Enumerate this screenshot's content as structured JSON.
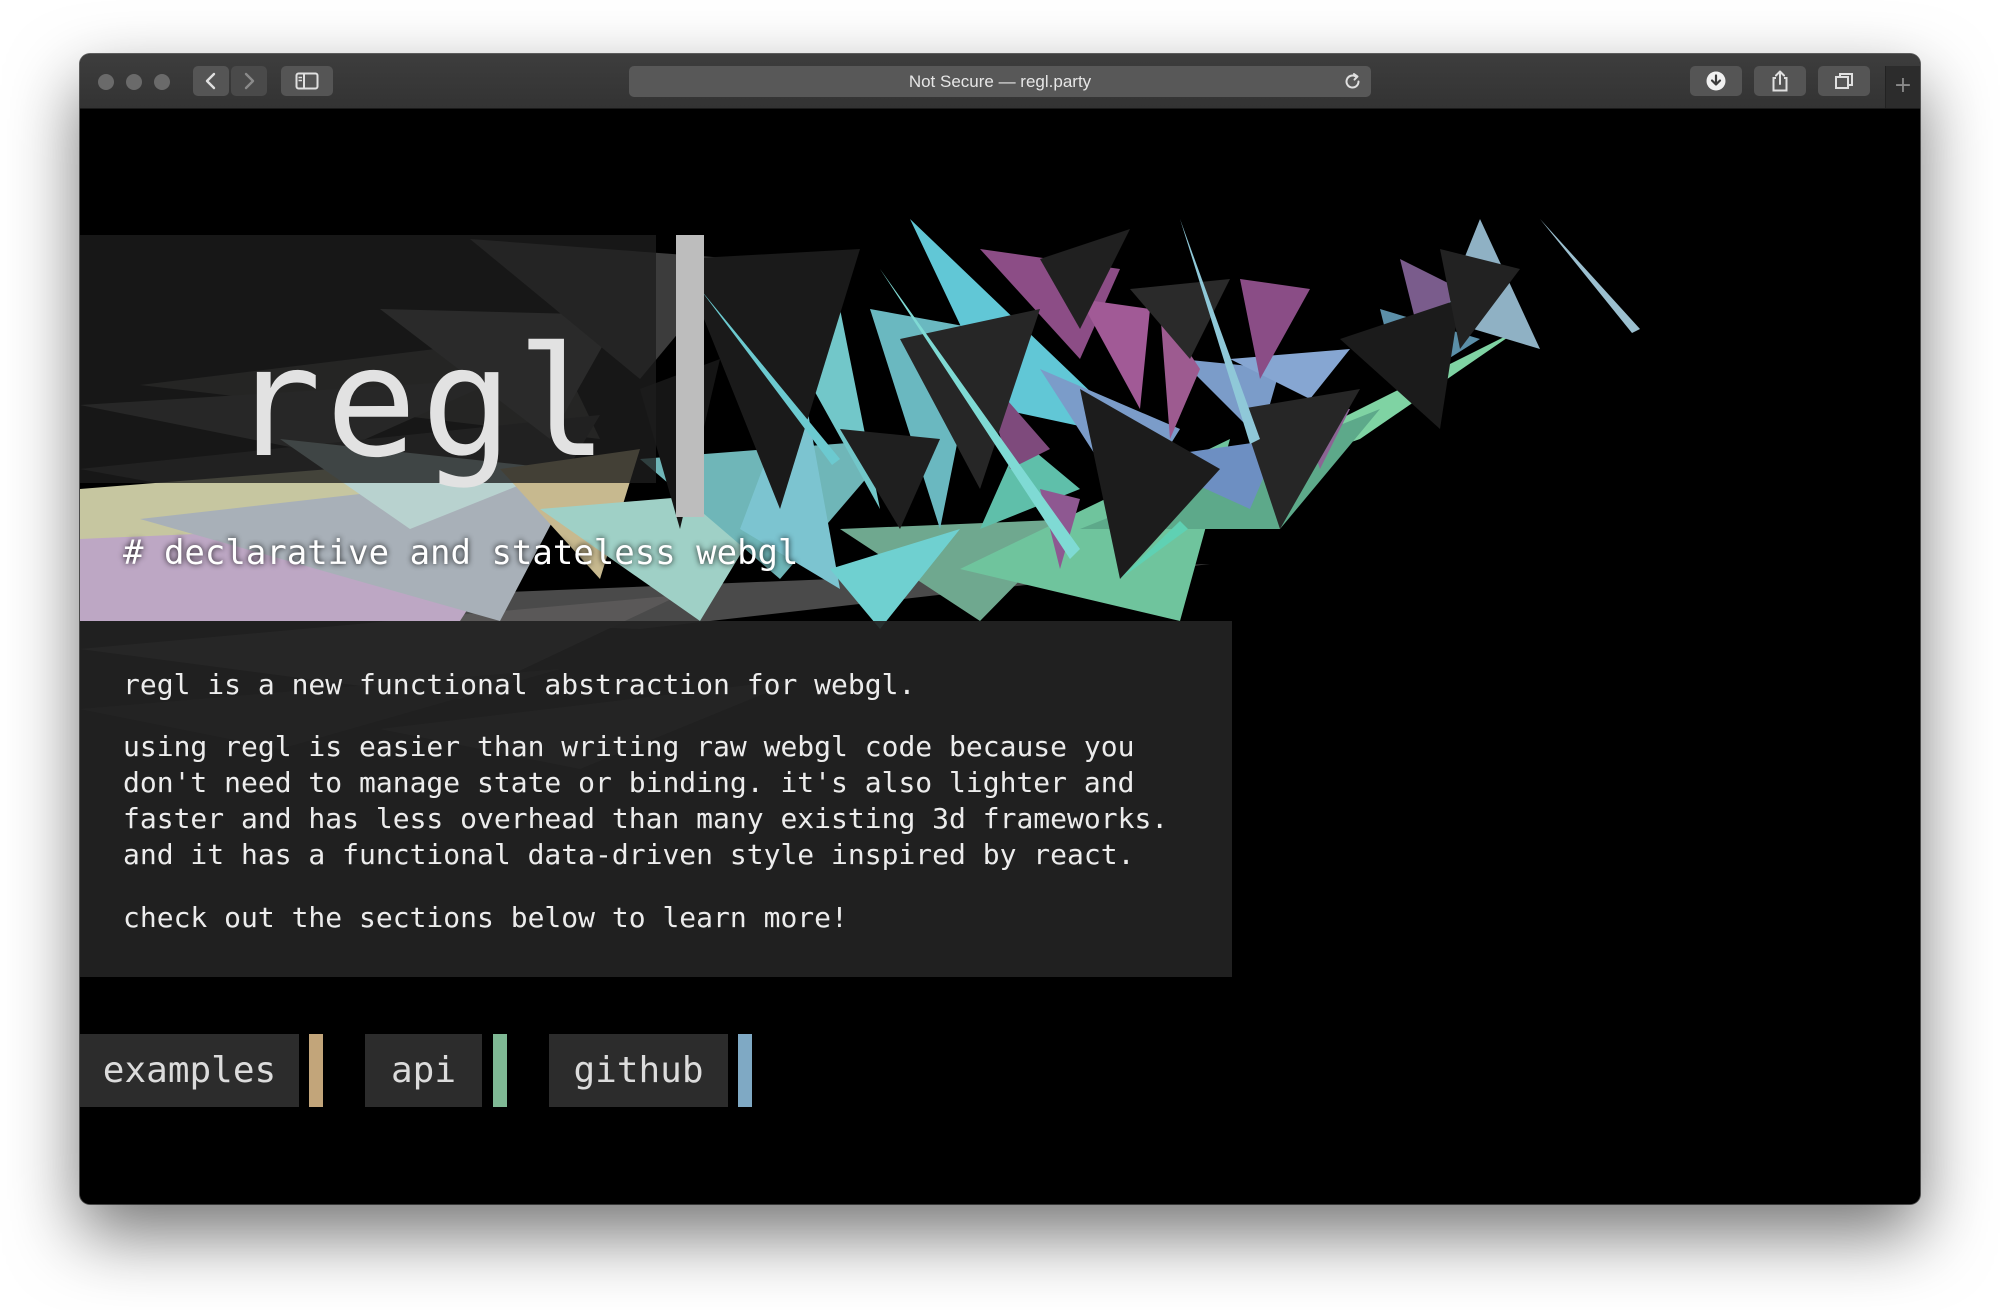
{
  "browser": {
    "url_text": "Not Secure — regl.party",
    "traffic_lights": [
      "close",
      "minimize",
      "zoom"
    ],
    "new_tab_label": "+"
  },
  "hero": {
    "logo": "regl",
    "tagline": "# declarative and stateless webgl"
  },
  "intro": {
    "line1": "regl is a new functional abstraction for webgl.",
    "para2": [
      "using regl is easier than writing raw webgl code because you",
      "don't need to manage state or binding. it's also lighter and",
      "faster and has less overhead than many existing 3d frameworks.",
      "and it has a functional data-driven style inspired by react."
    ],
    "line3": "check out the sections below to learn more!"
  },
  "nav": {
    "examples": "examples",
    "api": "api",
    "github": "github"
  },
  "colors": {
    "examples_accent": "#c2a57a",
    "api_accent": "#7eb894",
    "github_accent": "#7fa9c4",
    "teal": "#72c7c9",
    "purple": "#8c4d86",
    "blue": "#7b9cc9",
    "green": "#7fd3a3"
  }
}
